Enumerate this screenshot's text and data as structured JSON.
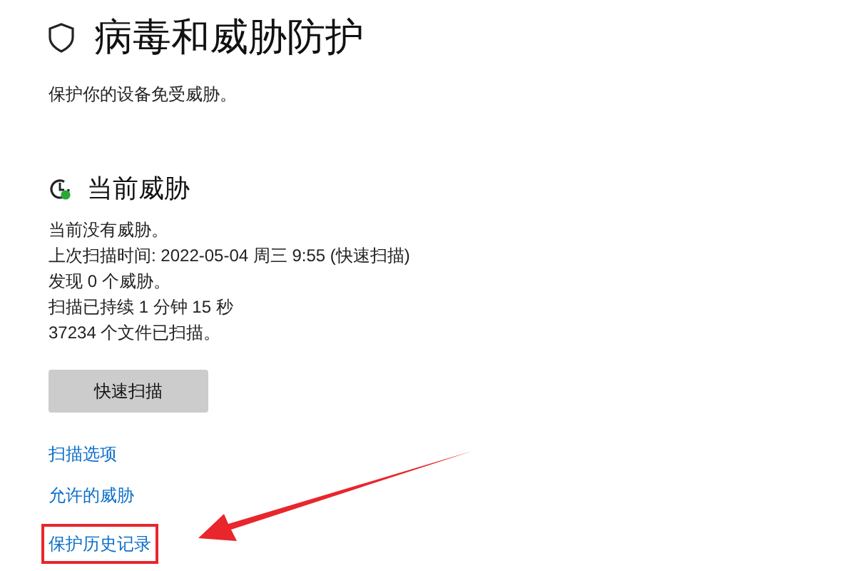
{
  "page": {
    "title": "病毒和威胁防护",
    "subtitle": "保护你的设备免受威胁。"
  },
  "section": {
    "heading": "当前威胁",
    "lines": [
      "当前没有威胁。",
      "上次扫描时间: 2022-05-04 周三 9:55 (快速扫描)",
      "发现 0 个威胁。",
      "扫描已持续 1 分钟 15 秒",
      "37234 个文件已扫描。"
    ],
    "button": "快速扫描"
  },
  "links": [
    {
      "label": "扫描选项",
      "highlighted": false
    },
    {
      "label": "允许的威胁",
      "highlighted": false
    },
    {
      "label": "保护历史记录",
      "highlighted": true
    }
  ],
  "callout_arrow": true
}
